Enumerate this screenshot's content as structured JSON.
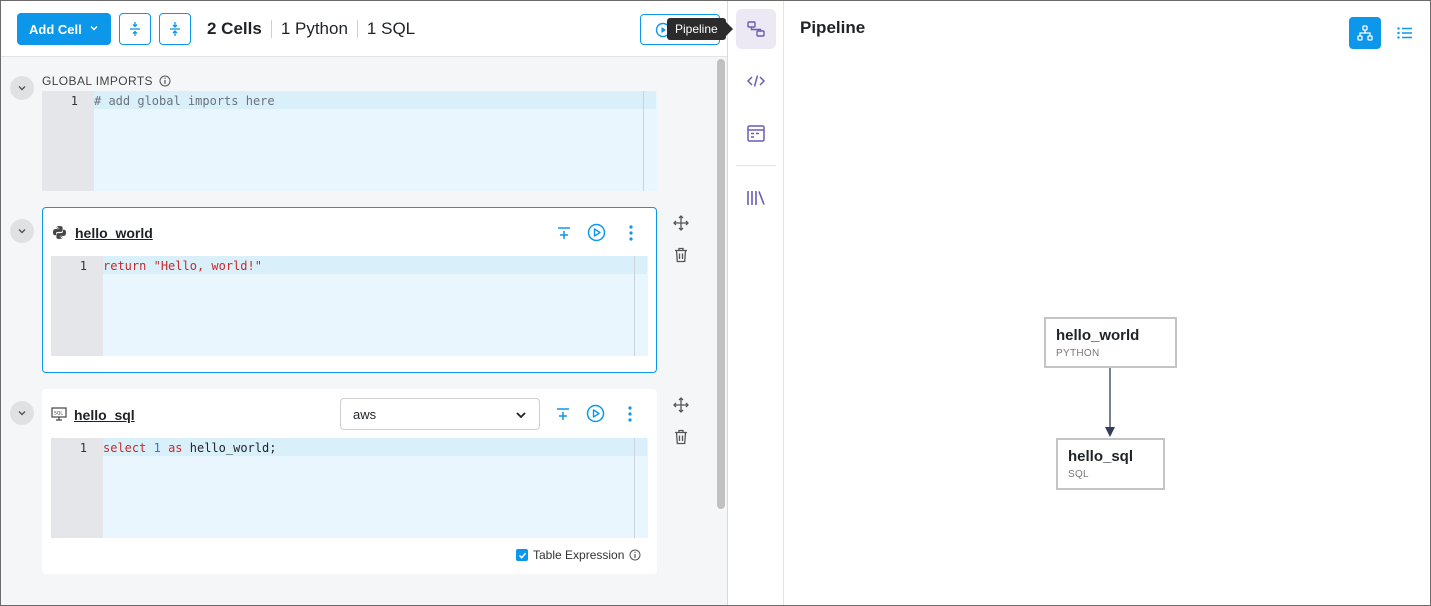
{
  "toolbar": {
    "add_cell_label": "Add Cell",
    "cells_count": "2 Cells",
    "python_count": "1 Python",
    "sql_count": "1 SQL",
    "tooltip": "Pipeline"
  },
  "global_imports": {
    "label": "GLOBAL IMPORTS",
    "line_number": "1",
    "code": "# add global imports here"
  },
  "cells": [
    {
      "name": "hello_world",
      "language": "python",
      "line_number": "1",
      "code_keyword": "return",
      "code_string": "\"Hello, world!\""
    },
    {
      "name": "hello_sql",
      "language": "sql",
      "connection": "aws",
      "line_number": "1",
      "code_kw1": "select",
      "code_num": "1",
      "code_kw2": "as",
      "code_rest": "hello_world;",
      "table_expression_label": "Table Expression",
      "table_expression_checked": true
    }
  ],
  "pipeline": {
    "title": "Pipeline",
    "nodes": [
      {
        "name": "hello_world",
        "type": "PYTHON"
      },
      {
        "name": "hello_sql",
        "type": "SQL"
      }
    ]
  },
  "colors": {
    "accent": "#0d97ea",
    "rail_icon": "#6b5bb5",
    "editor_bg": "#e9f6fd"
  }
}
